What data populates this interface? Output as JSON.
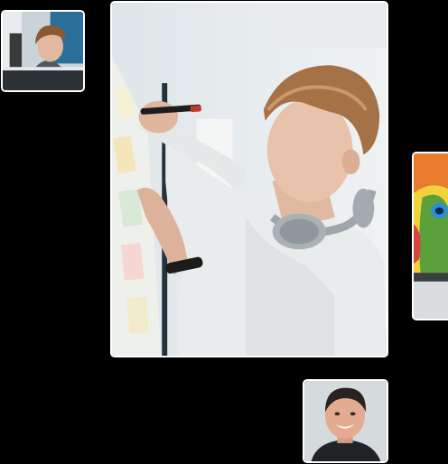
{
  "colors": {
    "background": "#000000",
    "tile_border": "#ffffff"
  },
  "tiles": [
    {
      "subject": "man-at-desk-with-earbuds-photo"
    },
    {
      "subject": "man-writing-on-sticky-note-board-photo"
    },
    {
      "subject": "colorful-illustration-on-monitor-photo"
    },
    {
      "subject": "smiling-man-portrait-photo"
    }
  ]
}
